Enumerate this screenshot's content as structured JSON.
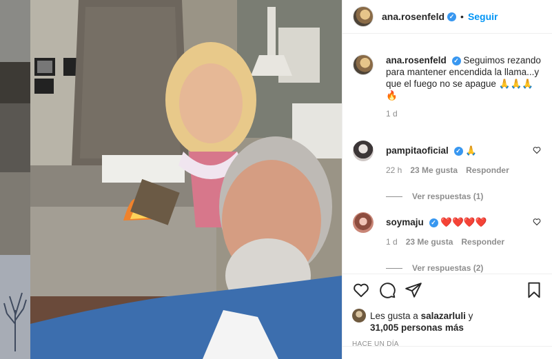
{
  "post": {
    "author": "ana.rosenfeld",
    "follow_label": "Seguir",
    "separator": "•",
    "caption": {
      "username": "ana.rosenfeld",
      "text": "Seguimos rezando para mantener encendida la llama...y que el fuego no se apague 🙏🙏🙏 🔥",
      "time": "1 d"
    },
    "comments": [
      {
        "username": "pampitaoficial",
        "text": "🙏",
        "time": "22 h",
        "likes": "23 Me gusta",
        "reply_label": "Responder",
        "view_replies": "Ver respuestas (1)"
      },
      {
        "username": "soymaju",
        "text": "❤️❤️❤️❤️",
        "time": "1 d",
        "likes": "23 Me gusta",
        "reply_label": "Responder",
        "view_replies": "Ver respuestas (2)"
      }
    ],
    "likes_prefix": "Les gusta a",
    "likes_user": "salazarluli",
    "likes_conjunction": "y",
    "likes_count": "31,005 personas más",
    "posted_ago": "HACE UN DÍA"
  },
  "colors": {
    "accent": "#0095f6",
    "verified": "#3897f0",
    "muted": "#8e8e8e",
    "text": "#262626",
    "heart": "#ed4956"
  },
  "icons": {
    "like": "heart-icon",
    "comment": "comment-icon",
    "share": "share-icon",
    "save": "bookmark-icon",
    "verified": "verified-badge-icon"
  }
}
